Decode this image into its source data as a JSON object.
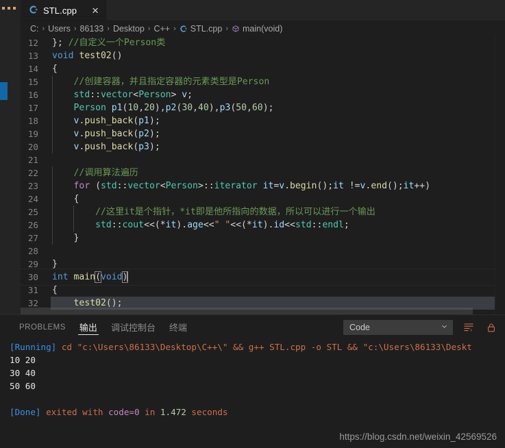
{
  "window": {
    "activity_bar": {
      "dots_icon": "more-dots-icon",
      "blue_marker": "#1267a8"
    }
  },
  "tab": {
    "label": "STL.cpp",
    "icon": "cpp-file-icon",
    "close_label": "✕"
  },
  "breadcrumb": {
    "separator": "›",
    "items": [
      {
        "label": "C:",
        "icon": ""
      },
      {
        "label": "Users",
        "icon": ""
      },
      {
        "label": "86133",
        "icon": ""
      },
      {
        "label": "Desktop",
        "icon": ""
      },
      {
        "label": "C++",
        "icon": ""
      },
      {
        "label": "STL.cpp",
        "icon": "cpp-file-icon"
      },
      {
        "label": "main(void)",
        "icon": "symbol-method-icon"
      }
    ]
  },
  "editor": {
    "lines": [
      {
        "num": "12",
        "indent": 0,
        "tokens": [
          {
            "t": "}; ",
            "c": "c-punc"
          },
          {
            "t": "//自定义一个Person类",
            "c": "c-comment"
          }
        ]
      },
      {
        "num": "13",
        "indent": 0,
        "tokens": [
          {
            "t": "void",
            "c": "c-key"
          },
          {
            "t": " ",
            "c": "c-punc"
          },
          {
            "t": "test02",
            "c": "c-fn"
          },
          {
            "t": "()",
            "c": "c-punc"
          }
        ]
      },
      {
        "num": "14",
        "indent": 0,
        "tokens": [
          {
            "t": "{",
            "c": "c-punc"
          }
        ]
      },
      {
        "num": "15",
        "indent": 1,
        "tokens": [
          {
            "t": "    ",
            "c": "c-punc"
          },
          {
            "t": "//创建容器，并且指定容器的元素类型是Person",
            "c": "c-comment"
          }
        ]
      },
      {
        "num": "16",
        "indent": 1,
        "tokens": [
          {
            "t": "    ",
            "c": "c-punc"
          },
          {
            "t": "std",
            "c": "c-ns"
          },
          {
            "t": "::",
            "c": "c-punc"
          },
          {
            "t": "vector",
            "c": "c-type"
          },
          {
            "t": "<",
            "c": "c-punc"
          },
          {
            "t": "Person",
            "c": "c-type"
          },
          {
            "t": "> ",
            "c": "c-punc"
          },
          {
            "t": "v",
            "c": "c-var"
          },
          {
            "t": ";",
            "c": "c-punc"
          }
        ]
      },
      {
        "num": "17",
        "indent": 1,
        "tokens": [
          {
            "t": "    ",
            "c": "c-punc"
          },
          {
            "t": "Person",
            "c": "c-type"
          },
          {
            "t": " ",
            "c": "c-punc"
          },
          {
            "t": "p1",
            "c": "c-var"
          },
          {
            "t": "(",
            "c": "c-punc"
          },
          {
            "t": "10",
            "c": "c-num"
          },
          {
            "t": ",",
            "c": "c-punc"
          },
          {
            "t": "20",
            "c": "c-num"
          },
          {
            "t": "),",
            "c": "c-punc"
          },
          {
            "t": "p2",
            "c": "c-var"
          },
          {
            "t": "(",
            "c": "c-punc"
          },
          {
            "t": "30",
            "c": "c-num"
          },
          {
            "t": ",",
            "c": "c-punc"
          },
          {
            "t": "40",
            "c": "c-num"
          },
          {
            "t": "),",
            "c": "c-punc"
          },
          {
            "t": "p3",
            "c": "c-var"
          },
          {
            "t": "(",
            "c": "c-punc"
          },
          {
            "t": "50",
            "c": "c-num"
          },
          {
            "t": ",",
            "c": "c-punc"
          },
          {
            "t": "60",
            "c": "c-num"
          },
          {
            "t": ");",
            "c": "c-punc"
          }
        ]
      },
      {
        "num": "18",
        "indent": 1,
        "tokens": [
          {
            "t": "    ",
            "c": "c-punc"
          },
          {
            "t": "v",
            "c": "c-var"
          },
          {
            "t": ".",
            "c": "c-punc"
          },
          {
            "t": "push_back",
            "c": "c-fn"
          },
          {
            "t": "(",
            "c": "c-punc"
          },
          {
            "t": "p1",
            "c": "c-var"
          },
          {
            "t": ");",
            "c": "c-punc"
          }
        ]
      },
      {
        "num": "19",
        "indent": 1,
        "tokens": [
          {
            "t": "    ",
            "c": "c-punc"
          },
          {
            "t": "v",
            "c": "c-var"
          },
          {
            "t": ".",
            "c": "c-punc"
          },
          {
            "t": "push_back",
            "c": "c-fn"
          },
          {
            "t": "(",
            "c": "c-punc"
          },
          {
            "t": "p2",
            "c": "c-var"
          },
          {
            "t": ");",
            "c": "c-punc"
          }
        ]
      },
      {
        "num": "20",
        "indent": 1,
        "tokens": [
          {
            "t": "    ",
            "c": "c-punc"
          },
          {
            "t": "v",
            "c": "c-var"
          },
          {
            "t": ".",
            "c": "c-punc"
          },
          {
            "t": "push_back",
            "c": "c-fn"
          },
          {
            "t": "(",
            "c": "c-punc"
          },
          {
            "t": "p3",
            "c": "c-var"
          },
          {
            "t": ");",
            "c": "c-punc"
          }
        ]
      },
      {
        "num": "21",
        "indent": 1,
        "tokens": []
      },
      {
        "num": "22",
        "indent": 1,
        "tokens": [
          {
            "t": "    ",
            "c": "c-punc"
          },
          {
            "t": "//调用算法遍历",
            "c": "c-comment"
          }
        ]
      },
      {
        "num": "23",
        "indent": 1,
        "tokens": [
          {
            "t": "    ",
            "c": "c-punc"
          },
          {
            "t": "for",
            "c": "c-key2"
          },
          {
            "t": " (",
            "c": "c-punc"
          },
          {
            "t": "std",
            "c": "c-ns"
          },
          {
            "t": "::",
            "c": "c-punc"
          },
          {
            "t": "vector",
            "c": "c-type"
          },
          {
            "t": "<",
            "c": "c-punc"
          },
          {
            "t": "Person",
            "c": "c-type"
          },
          {
            "t": ">::",
            "c": "c-punc"
          },
          {
            "t": "iterator",
            "c": "c-type"
          },
          {
            "t": " ",
            "c": "c-punc"
          },
          {
            "t": "it",
            "c": "c-var"
          },
          {
            "t": "=",
            "c": "c-punc"
          },
          {
            "t": "v",
            "c": "c-var"
          },
          {
            "t": ".",
            "c": "c-punc"
          },
          {
            "t": "begin",
            "c": "c-fn"
          },
          {
            "t": "();",
            "c": "c-punc"
          },
          {
            "t": "it",
            "c": "c-var"
          },
          {
            "t": " !=",
            "c": "c-punc"
          },
          {
            "t": "v",
            "c": "c-var"
          },
          {
            "t": ".",
            "c": "c-punc"
          },
          {
            "t": "end",
            "c": "c-fn"
          },
          {
            "t": "();",
            "c": "c-punc"
          },
          {
            "t": "it",
            "c": "c-var"
          },
          {
            "t": "++)",
            "c": "c-punc"
          }
        ]
      },
      {
        "num": "24",
        "indent": 1,
        "tokens": [
          {
            "t": "    ",
            "c": "c-punc"
          },
          {
            "t": "{",
            "c": "c-punc"
          }
        ]
      },
      {
        "num": "25",
        "indent": 2,
        "tokens": [
          {
            "t": "        ",
            "c": "c-punc"
          },
          {
            "t": "//这里it是个指针，*it即是他所指向的数据，所以可以进行一个输出",
            "c": "c-comment"
          }
        ]
      },
      {
        "num": "26",
        "indent": 2,
        "tokens": [
          {
            "t": "        ",
            "c": "c-punc"
          },
          {
            "t": "std",
            "c": "c-ns"
          },
          {
            "t": "::",
            "c": "c-punc"
          },
          {
            "t": "cout",
            "c": "c-type"
          },
          {
            "t": "<<(*",
            "c": "c-punc"
          },
          {
            "t": "it",
            "c": "c-var"
          },
          {
            "t": ").",
            "c": "c-punc"
          },
          {
            "t": "age",
            "c": "c-var"
          },
          {
            "t": "<<",
            "c": "c-punc"
          },
          {
            "t": "\" \"",
            "c": "c-str"
          },
          {
            "t": "<<(*",
            "c": "c-punc"
          },
          {
            "t": "it",
            "c": "c-var"
          },
          {
            "t": ").",
            "c": "c-punc"
          },
          {
            "t": "id",
            "c": "c-var"
          },
          {
            "t": "<<",
            "c": "c-punc"
          },
          {
            "t": "std",
            "c": "c-ns"
          },
          {
            "t": "::",
            "c": "c-punc"
          },
          {
            "t": "endl",
            "c": "c-type"
          },
          {
            "t": ";",
            "c": "c-punc"
          }
        ]
      },
      {
        "num": "27",
        "indent": 1,
        "tokens": [
          {
            "t": "    ",
            "c": "c-punc"
          },
          {
            "t": "}",
            "c": "c-punc"
          }
        ]
      },
      {
        "num": "28",
        "indent": 1,
        "tokens": []
      },
      {
        "num": "29",
        "indent": 0,
        "tokens": [
          {
            "t": "}",
            "c": "c-punc"
          }
        ]
      },
      {
        "num": "30",
        "indent": 0,
        "cursorline": true,
        "tokens": [
          {
            "t": "int",
            "c": "c-key"
          },
          {
            "t": " ",
            "c": "c-punc"
          },
          {
            "t": "main",
            "c": "c-fn"
          },
          {
            "t": "(",
            "c": "c-punc",
            "box": true
          },
          {
            "t": "void",
            "c": "c-key"
          },
          {
            "t": ")",
            "c": "c-punc",
            "box": true
          },
          {
            "t": "",
            "c": "caret"
          }
        ]
      },
      {
        "num": "31",
        "indent": 0,
        "tokens": [
          {
            "t": "{",
            "c": "c-punc"
          }
        ]
      },
      {
        "num": "32",
        "indent": 1,
        "selected": true,
        "tokens": [
          {
            "t": "    ",
            "c": "c-punc"
          },
          {
            "t": "test02",
            "c": "c-fn"
          },
          {
            "t": "();",
            "c": "c-punc"
          }
        ]
      }
    ]
  },
  "panel": {
    "tabs": [
      {
        "label": "PROBLEMS",
        "active": false,
        "cjk": false
      },
      {
        "label": "输出",
        "active": true,
        "cjk": true
      },
      {
        "label": "调试控制台",
        "active": false,
        "cjk": true
      },
      {
        "label": "终端",
        "active": false,
        "cjk": true
      }
    ],
    "channel_select": {
      "value": "Code",
      "chevron": "⌄"
    },
    "actions": [
      {
        "name": "clear-output-icon",
        "title": "Clear Output"
      },
      {
        "name": "lock-scroll-icon",
        "title": "Turn Auto Scrolling Off"
      }
    ],
    "output_lines": [
      {
        "segments": [
          {
            "t": "[Running]",
            "c": "t-blue"
          },
          {
            "t": " cd \"c:\\Users\\86133\\Desktop\\C++\\\" && g++ STL.cpp -o STL && \"c:\\Users\\86133\\Deskt",
            "c": "t-orange"
          }
        ]
      },
      {
        "segments": [
          {
            "t": "10 20",
            "c": "t-plain"
          }
        ]
      },
      {
        "segments": [
          {
            "t": "30 40",
            "c": "t-plain"
          }
        ]
      },
      {
        "segments": [
          {
            "t": "50 60",
            "c": "t-plain"
          }
        ]
      },
      {
        "segments": [
          {
            "t": "",
            "c": "t-plain"
          }
        ]
      },
      {
        "segments": [
          {
            "t": "[Done]",
            "c": "t-blue"
          },
          {
            "t": " exited with ",
            "c": "t-orange"
          },
          {
            "t": "code=0",
            "c": "t-pink"
          },
          {
            "t": " in ",
            "c": "t-orange"
          },
          {
            "t": "1.472",
            "c": "t-green"
          },
          {
            "t": " seconds",
            "c": "t-orange"
          }
        ]
      }
    ],
    "watermark": "https://blog.csdn.net/weixin_42569526"
  }
}
